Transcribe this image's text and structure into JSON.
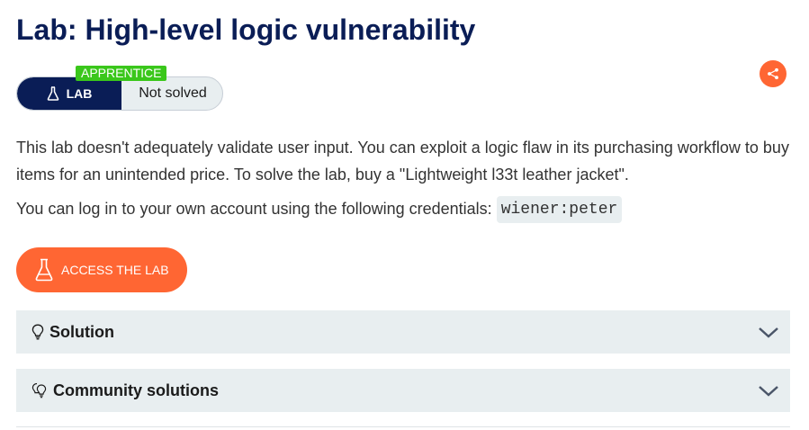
{
  "title": "Lab: High-level logic vulnerability",
  "status": {
    "level_badge": "APPRENTICE",
    "lab_label": "LAB",
    "solved_label": "Not solved"
  },
  "description": "This lab doesn't adequately validate user input. You can exploit a logic flaw in its purchasing workflow to buy items for an unintended price. To solve the lab, buy a \"Lightweight l33t leather jacket\".",
  "credentials": {
    "text": "You can log in to your own account using the following credentials:",
    "value": "wiener:peter"
  },
  "access_button_label": "ACCESS THE LAB",
  "accordions": {
    "solution_label": "Solution",
    "community_label": "Community solutions"
  },
  "colors": {
    "title": "#0a1d56",
    "accent": "#ff6633",
    "badge": "#3ac71b",
    "panel": "#e8eef0"
  },
  "icons": {
    "lab": "flask-icon",
    "share": "share-icon",
    "access": "flask-icon",
    "solution": "lightbulb-icon",
    "community": "lightbulbs-icon",
    "expand": "chevron-down-icon"
  }
}
